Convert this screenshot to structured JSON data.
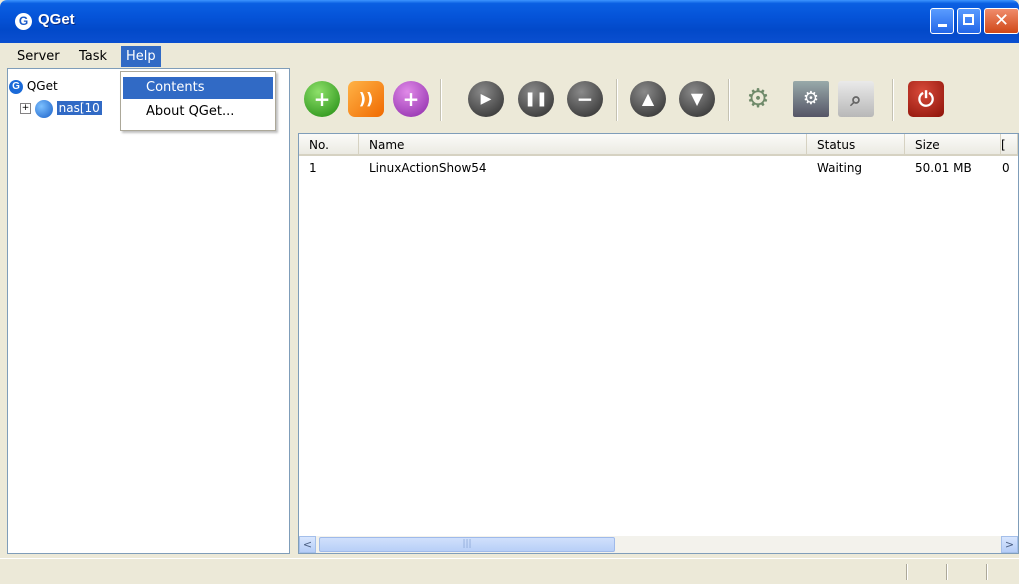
{
  "window": {
    "title": "QGet",
    "app_icon_letter": "G"
  },
  "menubar": {
    "items": [
      "Server",
      "Task",
      "Help"
    ],
    "active": "Help"
  },
  "help_menu": {
    "items": [
      "Contents",
      "About QGet..."
    ],
    "highlighted": "Contents"
  },
  "tree": {
    "root_label": "QGet",
    "child_label": "nas[10",
    "expander": "+"
  },
  "toolbar": {
    "buttons": [
      "add-task-icon",
      "rss-add-icon",
      "add-purple-icon",
      "start-icon",
      "pause-icon",
      "stop-icon",
      "move-up-icon",
      "move-down-icon",
      "settings-gears-icon",
      "server-config-icon",
      "search-icon",
      "power-icon"
    ]
  },
  "table": {
    "columns": [
      "No.",
      "Name",
      "Status",
      "Size",
      "["
    ],
    "rows": [
      {
        "no": "1",
        "name": "LinuxActionShow54",
        "status": "Waiting",
        "size": "50.01 MB",
        "extra": "0"
      }
    ]
  },
  "scrollbar": {
    "left_arrow": "<",
    "right_arrow": ">",
    "thumb_grip": "|||"
  },
  "colors": {
    "selection": "#316ac5",
    "titlebar": "#0553d8"
  }
}
